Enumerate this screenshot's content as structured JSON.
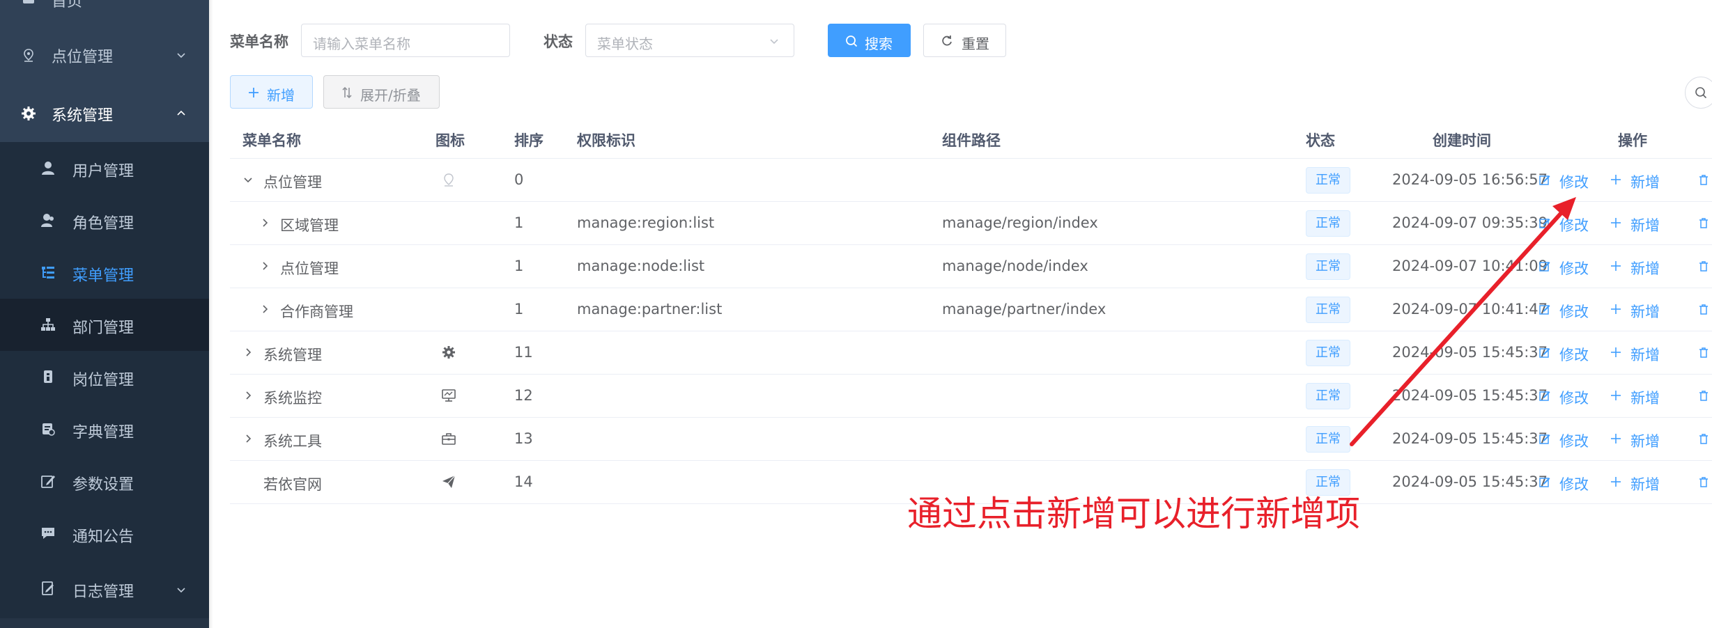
{
  "sidebar": {
    "items": [
      {
        "label": "首页",
        "icon": "home-icon"
      },
      {
        "label": "点位管理",
        "icon": "location-pin-icon",
        "expanded": false
      },
      {
        "label": "系统管理",
        "icon": "gear-icon",
        "expanded": true
      },
      {
        "label": "用户管理",
        "icon": "user-icon"
      },
      {
        "label": "角色管理",
        "icon": "people-icon"
      },
      {
        "label": "菜单管理",
        "icon": "tree-table-icon",
        "active": true
      },
      {
        "label": "部门管理",
        "icon": "org-tree-icon"
      },
      {
        "label": "岗位管理",
        "icon": "badge-icon"
      },
      {
        "label": "字典管理",
        "icon": "dictionary-icon"
      },
      {
        "label": "参数设置",
        "icon": "edit-settings-icon"
      },
      {
        "label": "通知公告",
        "icon": "message-icon"
      },
      {
        "label": "日志管理",
        "icon": "log-icon",
        "expanded": false
      }
    ]
  },
  "search": {
    "name_label": "菜单名称",
    "name_placeholder": "请输入菜单名称",
    "status_label": "状态",
    "status_placeholder": "菜单状态",
    "search_button": "搜索",
    "reset_button": "重置"
  },
  "toolbar": {
    "add_button": "新增",
    "expand_button": "展开/折叠"
  },
  "table": {
    "headers": [
      "菜单名称",
      "图标",
      "排序",
      "权限标识",
      "组件路径",
      "状态",
      "创建时间",
      "操作"
    ],
    "rows": [
      {
        "name": "点位管理",
        "order": "0",
        "perms": "",
        "component": "",
        "status": "正常",
        "created": "2024-09-05 16:56:57"
      },
      {
        "name": "区域管理",
        "order": "1",
        "perms": "manage:region:list",
        "component": "manage/region/index",
        "status": "正常",
        "created": "2024-09-07 09:35:39"
      },
      {
        "name": "点位管理",
        "order": "1",
        "perms": "manage:node:list",
        "component": "manage/node/index",
        "status": "正常",
        "created": "2024-09-07 10:41:09"
      },
      {
        "name": "合作商管理",
        "order": "1",
        "perms": "manage:partner:list",
        "component": "manage/partner/index",
        "status": "正常",
        "created": "2024-09-07 10:41:47"
      },
      {
        "name": "系统管理",
        "order": "11",
        "perms": "",
        "component": "",
        "status": "正常",
        "created": "2024-09-05 15:45:37"
      },
      {
        "name": "系统监控",
        "order": "12",
        "perms": "",
        "component": "",
        "status": "正常",
        "created": "2024-09-05 15:45:37"
      },
      {
        "name": "系统工具",
        "order": "13",
        "perms": "",
        "component": "",
        "status": "正常",
        "created": "2024-09-05 15:45:37"
      },
      {
        "name": "若依官网",
        "order": "14",
        "perms": "",
        "component": "",
        "status": "正常",
        "created": "2024-09-05 15:45:37"
      }
    ],
    "op_edit": "修改",
    "op_add": "新增"
  },
  "annotation": {
    "text": "通过点击新增可以进行新增项",
    "color": "#e8202a"
  },
  "colors": {
    "sidebar_bg": "#304156",
    "submenu_bg": "#1f2d3d",
    "primary": "#409eff",
    "text": "#606266"
  }
}
